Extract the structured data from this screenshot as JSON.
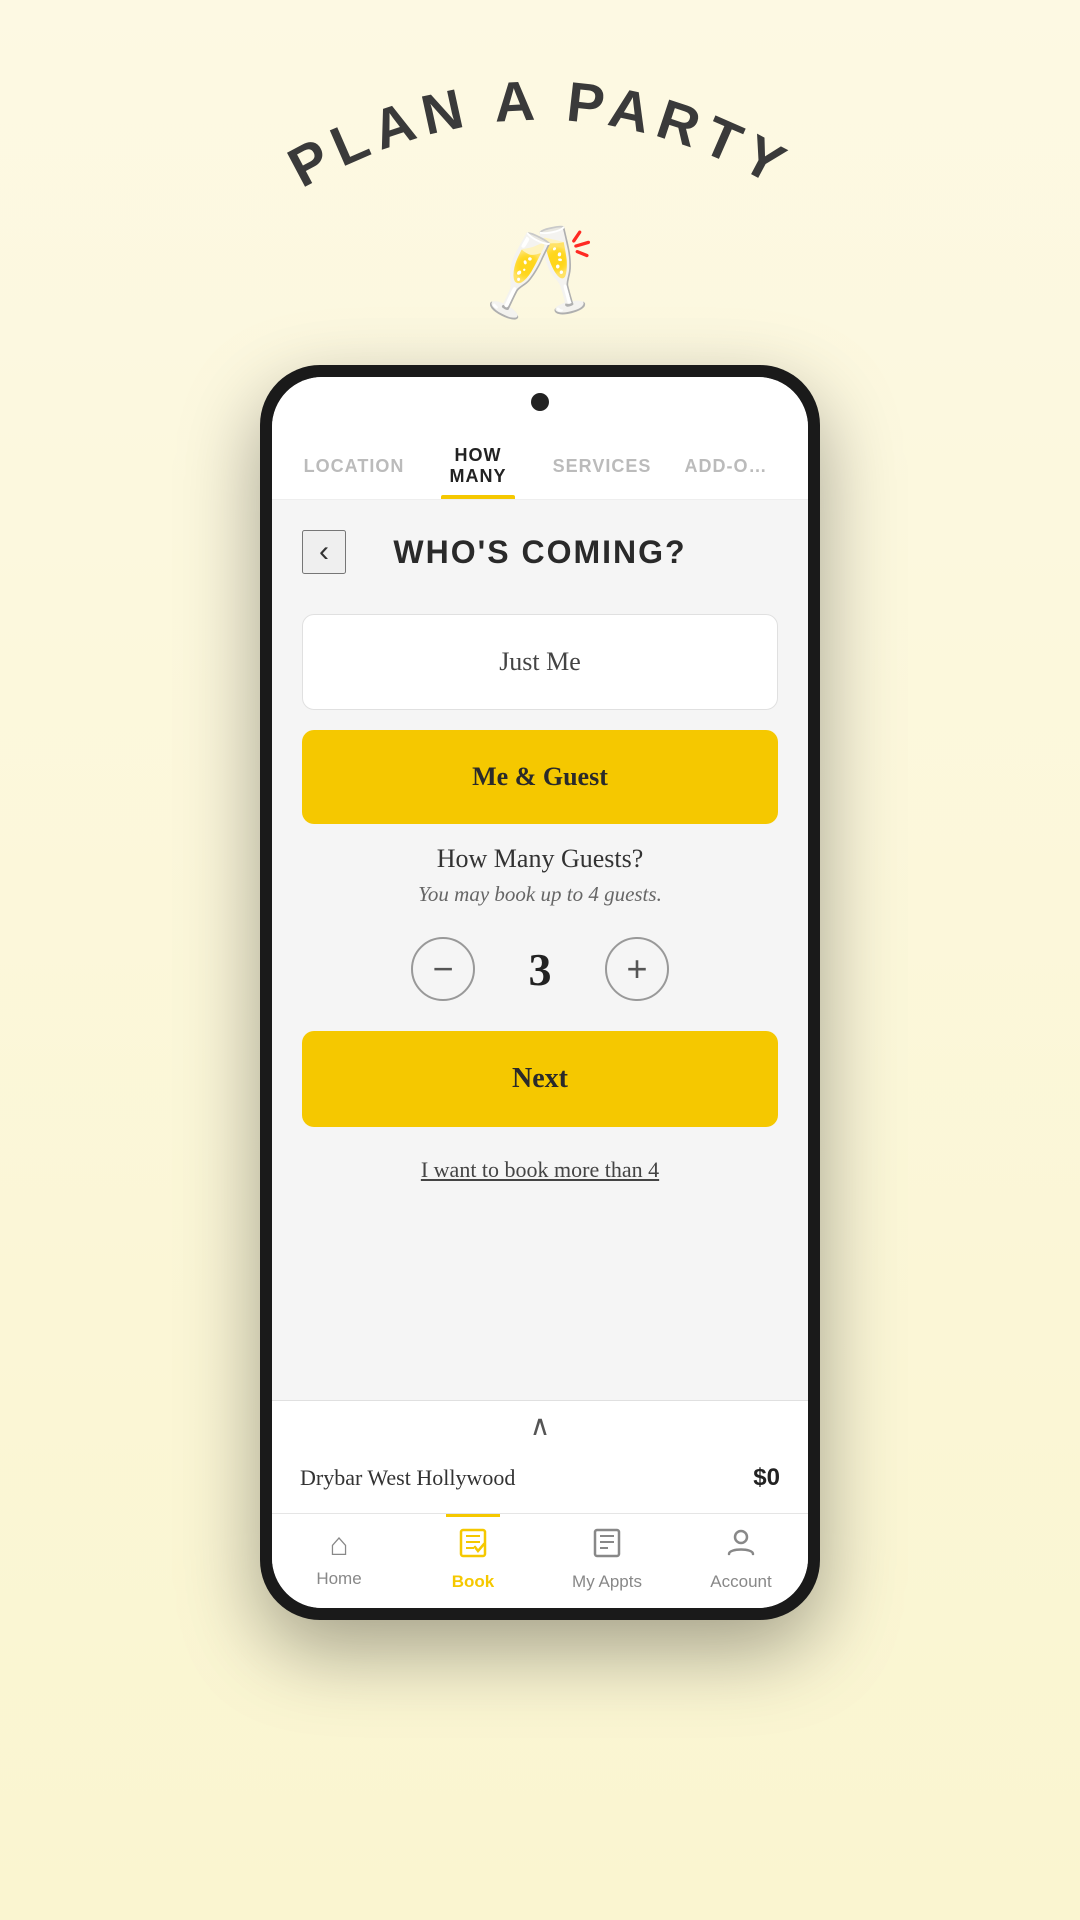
{
  "app": {
    "title": "PLAN A PARTY",
    "icon": "🥂"
  },
  "tabs": [
    {
      "id": "location",
      "label": "LOCATION",
      "state": "inactive"
    },
    {
      "id": "how-many",
      "label": "HOW MANY",
      "state": "active"
    },
    {
      "id": "services",
      "label": "SERVICES",
      "state": "inactive"
    },
    {
      "id": "add-ons",
      "label": "ADD-O…",
      "state": "dimmed"
    }
  ],
  "page": {
    "title": "WHO'S COMING?",
    "back_label": "<"
  },
  "options": [
    {
      "id": "just-me",
      "label": "Just Me",
      "state": "inactive"
    },
    {
      "id": "me-guest",
      "label": "Me & Guest",
      "state": "active"
    }
  ],
  "guests": {
    "title": "How Many Guests?",
    "subtitle": "You may book up to 4 guests.",
    "count": "3",
    "decrement_label": "−",
    "increment_label": "+"
  },
  "actions": {
    "next_label": "Next",
    "book_more_label": "I want to book more than 4"
  },
  "summary": {
    "collapse_icon": "∧",
    "location": "Drybar West Hollywood",
    "price": "$0"
  },
  "nav": [
    {
      "id": "home",
      "label": "Home",
      "icon": "🏠",
      "state": "inactive"
    },
    {
      "id": "book",
      "label": "Book",
      "icon": "📅",
      "state": "active"
    },
    {
      "id": "my-appts",
      "label": "My Appts",
      "icon": "📋",
      "state": "inactive"
    },
    {
      "id": "account",
      "label": "Account",
      "icon": "👤",
      "state": "inactive"
    }
  ]
}
